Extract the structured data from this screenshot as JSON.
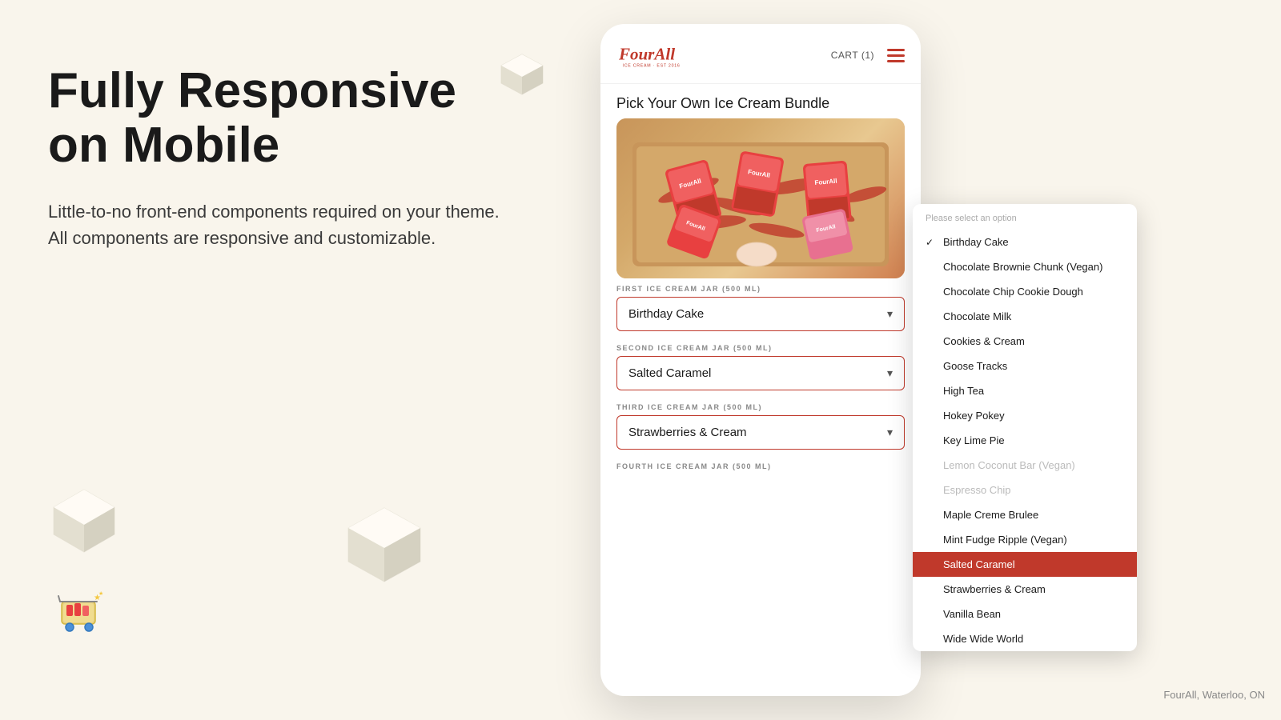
{
  "page": {
    "background_color": "#f9f5ec"
  },
  "left": {
    "heading_line1": "Fully Responsive",
    "heading_line2": "on Mobile",
    "subtext": "Little-to-no front-end components required on your theme. All components are responsive and customizable."
  },
  "phone": {
    "logo": "FourAll",
    "logo_sub": "ICE CREAM · EST 2016",
    "cart_label": "CART (1)",
    "product_title": "Pick Your Own Ice Cream Bundle",
    "jar_labels": [
      "FIRST ICE CREAM JAR (500 ML)",
      "SECOND ICE CREAM JAR (500 ML)",
      "THIRD ICE CREAM JAR (500 ML)",
      "FOURTH ICE CREAM JAR (500 ML)"
    ],
    "selected_flavors": [
      "Birthday Cake",
      "Salted Caramel",
      "Strawberries & Cream",
      ""
    ]
  },
  "dropdown": {
    "header": "Please select an option",
    "items": [
      {
        "label": "Birthday Cake",
        "checked": true,
        "disabled": false,
        "selected": false
      },
      {
        "label": "Chocolate Brownie Chunk (Vegan)",
        "checked": false,
        "disabled": false,
        "selected": false
      },
      {
        "label": "Chocolate Chip Cookie Dough",
        "checked": false,
        "disabled": false,
        "selected": false
      },
      {
        "label": "Chocolate Milk",
        "checked": false,
        "disabled": false,
        "selected": false
      },
      {
        "label": "Cookies & Cream",
        "checked": false,
        "disabled": false,
        "selected": false
      },
      {
        "label": "Goose Tracks",
        "checked": false,
        "disabled": false,
        "selected": false
      },
      {
        "label": "High Tea",
        "checked": false,
        "disabled": false,
        "selected": false
      },
      {
        "label": "Hokey Pokey",
        "checked": false,
        "disabled": false,
        "selected": false
      },
      {
        "label": "Key Lime Pie",
        "checked": false,
        "disabled": false,
        "selected": false
      },
      {
        "label": "Lemon Coconut Bar (Vegan)",
        "checked": false,
        "disabled": true,
        "selected": false
      },
      {
        "label": "Espresso Chip",
        "checked": false,
        "disabled": true,
        "selected": false
      },
      {
        "label": "Maple Creme Brulee",
        "checked": false,
        "disabled": false,
        "selected": false
      },
      {
        "label": "Mint Fudge Ripple (Vegan)",
        "checked": false,
        "disabled": false,
        "selected": false
      },
      {
        "label": "Salted Caramel",
        "checked": false,
        "disabled": false,
        "selected": true
      },
      {
        "label": "Strawberries & Cream",
        "checked": false,
        "disabled": false,
        "selected": false
      },
      {
        "label": "Vanilla Bean",
        "checked": false,
        "disabled": false,
        "selected": false
      },
      {
        "label": "Wide Wide World",
        "checked": false,
        "disabled": false,
        "selected": false
      }
    ]
  },
  "footer": {
    "location": "FourAll, Waterloo, ON"
  }
}
